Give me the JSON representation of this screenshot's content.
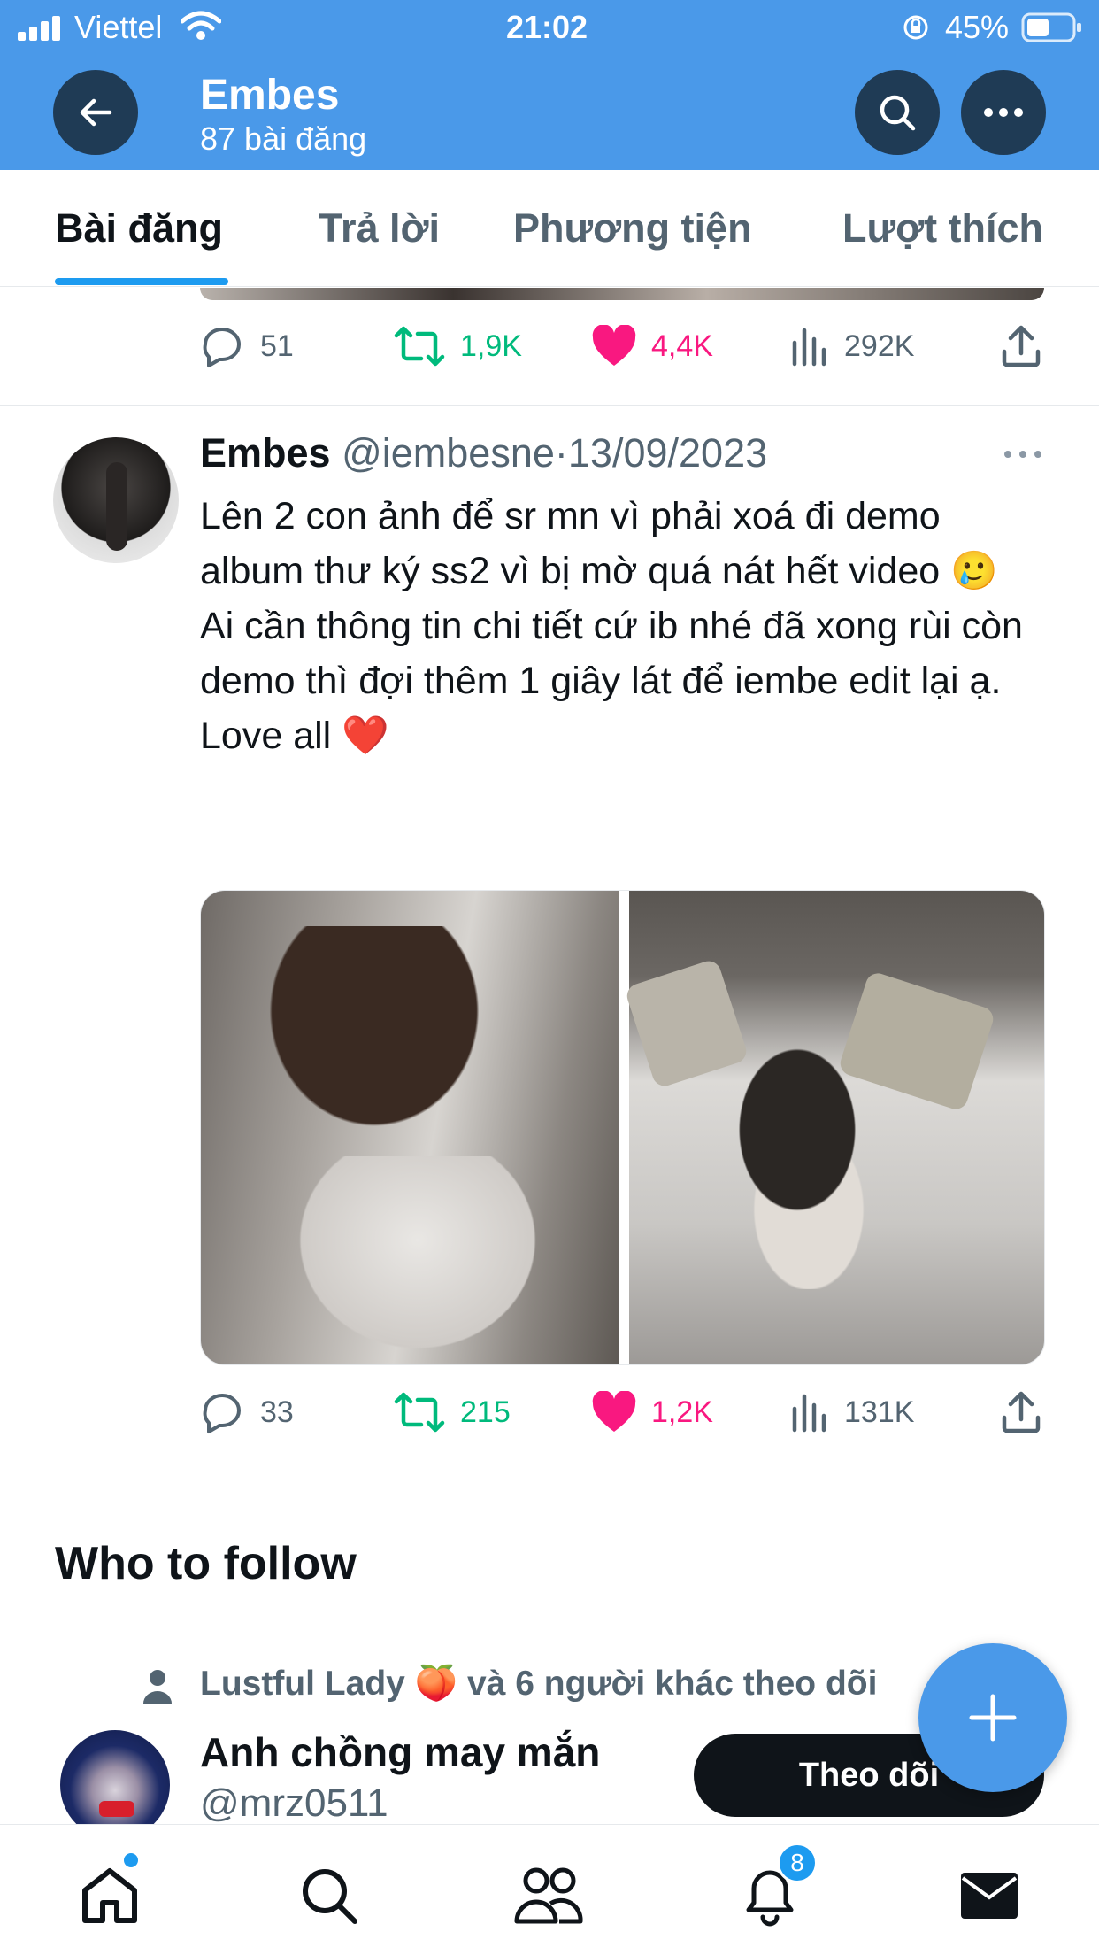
{
  "status_bar": {
    "carrier": "Viettel",
    "time": "21:02",
    "battery": "45%"
  },
  "header": {
    "title": "Embes",
    "subtitle": "87 bài đăng"
  },
  "tabs": [
    {
      "label": "Bài đăng",
      "active": true
    },
    {
      "label": "Trả lời",
      "active": false
    },
    {
      "label": "Phương tiện",
      "active": false
    },
    {
      "label": "Lượt thích",
      "active": false
    }
  ],
  "prev_tweet_actions": {
    "replies": "51",
    "retweets": "1,9K",
    "likes": "4,4K",
    "views": "292K"
  },
  "tweet": {
    "name": "Embes",
    "handle": "@iembesne",
    "separator": "·",
    "date": "13/09/2023",
    "text_line1": "Lên 2 con ảnh để sr mn vì phải xoá đi demo album thư ký ss2 vì bị mờ quá nát hết video",
    "emoji_cry": "🥲",
    "text_line2": "Ai cần thông tin chi tiết cứ ib nhé đã xong rùi còn demo thì đợi thêm 1 giây lát để iembe edit lại ạ.",
    "text_line3": "Love all",
    "emoji_heart": "❤️",
    "actions": {
      "replies": "33",
      "retweets": "215",
      "likes": "1,2K",
      "views": "131K"
    }
  },
  "who_to_follow": {
    "title": "Who to follow",
    "social_context": "Lustful Lady 🍑 và 6 người khác theo dõi",
    "suggestion": {
      "name": "Anh chồng may mắn",
      "handle": "@mrz0511",
      "follow_label": "Theo dõi"
    }
  },
  "bottom_nav": {
    "notifications_badge": "8"
  },
  "colors": {
    "brand_blue": "#4a99e9",
    "like_pink": "#f91880",
    "retweet_green": "#00ba7c",
    "text_secondary": "#536471"
  }
}
